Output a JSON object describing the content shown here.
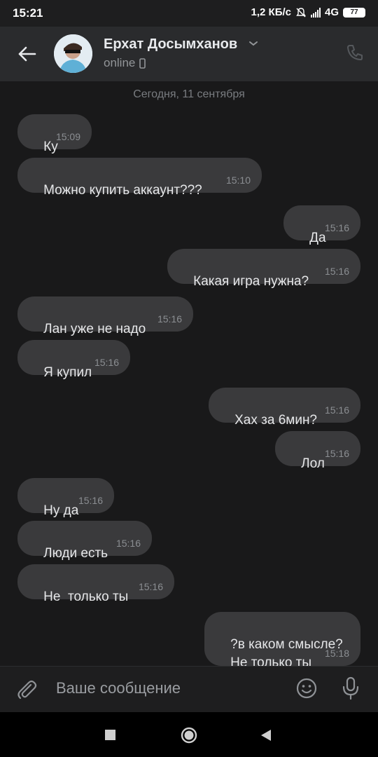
{
  "status_bar": {
    "time": "15:21",
    "net_speed": "1,2 КБ/с",
    "network_type": "4G",
    "battery": "77",
    "icons": [
      "mute-bell-icon",
      "signal-icon",
      "battery-icon"
    ]
  },
  "header": {
    "contact_name": "Ерхат Досымханов",
    "status": "online",
    "icons": [
      "back-arrow-icon",
      "chevron-down-icon",
      "mobile-device-icon",
      "phone-icon"
    ]
  },
  "chat": {
    "date_separator": "Сегодня, 11 сентября",
    "messages": [
      {
        "dir": "in",
        "text": "Ку",
        "time": "15:09"
      },
      {
        "dir": "in",
        "text": "Можно купить аккаунт???",
        "time": "15:10"
      },
      {
        "dir": "out",
        "text": "Да",
        "time": "15:16"
      },
      {
        "dir": "out",
        "text": "Какая игра нужна?",
        "time": "15:16"
      },
      {
        "dir": "in",
        "text": "Лан уже не надо",
        "time": "15:16"
      },
      {
        "dir": "in",
        "text": "Я купил",
        "time": "15:16"
      },
      {
        "dir": "out",
        "text": "Хах за 6мин?",
        "time": "15:16"
      },
      {
        "dir": "out",
        "text": "Лол",
        "time": "15:16"
      },
      {
        "dir": "in",
        "text": "Ну да",
        "time": "15:16"
      },
      {
        "dir": "in",
        "text": "Люди есть",
        "time": "15:16"
      },
      {
        "dir": "in",
        "text": "Не  только ты",
        "time": "15:16"
      },
      {
        "dir": "out",
        "text": "?в каком смысле?\nНе только ты",
        "time": "15:18"
      }
    ]
  },
  "composer": {
    "placeholder": "Ваше сообщение",
    "icons": [
      "attach-paperclip-icon",
      "emoji-icon",
      "microphone-icon"
    ]
  },
  "nav_bar": {
    "icons": [
      "recents-square-icon",
      "home-circle-icon",
      "back-triangle-icon"
    ]
  },
  "colors": {
    "background": "#19191a",
    "header": "#2a2b2d",
    "bubble": "#3a3a3c",
    "text": "#e6e7e9",
    "muted": "#8b8e92"
  }
}
